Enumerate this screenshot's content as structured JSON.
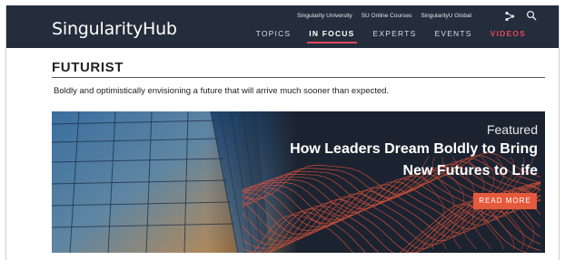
{
  "header": {
    "logo": "SingularityHub",
    "util_links": [
      "Singularity University",
      "SU Online Courses",
      "SingularityU Global"
    ],
    "nav": [
      {
        "label": "TOPICS",
        "state": "normal"
      },
      {
        "label": "IN FOCUS",
        "state": "active"
      },
      {
        "label": "EXPERTS",
        "state": "normal"
      },
      {
        "label": "EVENTS",
        "state": "normal"
      },
      {
        "label": "VIDEOS",
        "state": "accent"
      }
    ],
    "icons": [
      "share-icon",
      "search-icon"
    ],
    "colors": {
      "bar": "#232d3b",
      "accent": "#e8465a"
    }
  },
  "section": {
    "title": "FUTURIST",
    "description": "Boldly and optimistically envisioning a future that will arrive much sooner than expected."
  },
  "featured": {
    "label": "Featured",
    "title": "How Leaders Dream Boldly to Bring New Futures to Life",
    "button": "READ MORE",
    "colors": {
      "button": "#e55a3c",
      "waves": "#e2553a"
    }
  }
}
